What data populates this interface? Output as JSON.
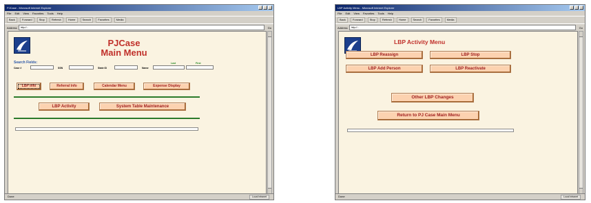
{
  "left_window": {
    "title": "PJCase - Microsoft Internet Explorer",
    "menu": [
      "File",
      "Edit",
      "View",
      "Favorites",
      "Tools",
      "Help"
    ],
    "toolbar": [
      "Back",
      "Forward",
      "Stop",
      "Refresh",
      "Home",
      "Search",
      "Favorites",
      "Media"
    ],
    "address_label": "Address",
    "address": "http://...",
    "go": "Go",
    "status": "Done",
    "zone": "Local intranet",
    "page": {
      "title_line1": "PJCase",
      "title_line2": "Main Menu",
      "search_label": "Search Fields:",
      "fields": [
        {
          "label": "Case #"
        },
        {
          "label": "SSN"
        },
        {
          "label": "State ID"
        },
        {
          "label": "Name"
        }
      ],
      "name_sub": {
        "last": "Last",
        "first": "First"
      },
      "row1_buttons": [
        "LBP Info",
        "Referral Info",
        "Calendar Menu",
        "Expense Display"
      ],
      "row2_buttons": [
        "LBP Activity",
        "System Table Maintenance"
      ]
    }
  },
  "right_window": {
    "title": "LBP Activity Menu - Microsoft Internet Explorer",
    "menu": [
      "File",
      "Edit",
      "View",
      "Favorites",
      "Tools",
      "Help"
    ],
    "toolbar": [
      "Back",
      "Forward",
      "Stop",
      "Refresh",
      "Home",
      "Search",
      "Favorites",
      "Media"
    ],
    "address_label": "Address",
    "address": "http://...",
    "go": "Go",
    "status": "Done",
    "zone": "Local intranet",
    "page": {
      "title": "LBP Activity Menu",
      "grid_buttons": [
        "LBP Reassign",
        "LBP Stop",
        "LBP Add Person",
        "LBP Reactivate"
      ],
      "other_button": "Other LBP Changes",
      "return_button": "Return to PJ Case Main Menu"
    }
  }
}
